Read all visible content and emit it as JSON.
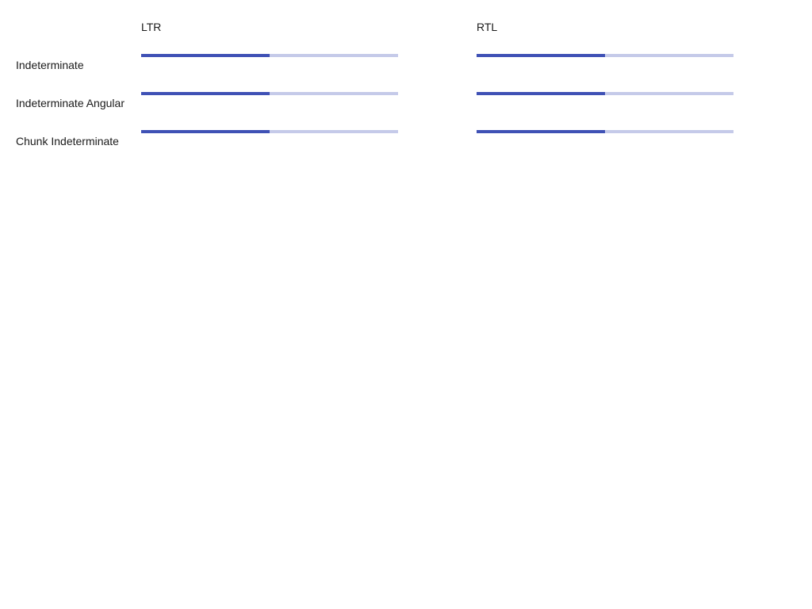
{
  "columns": {
    "ltr": "LTR",
    "rtl": "RTL"
  },
  "rows": [
    {
      "label": "Indeterminate"
    },
    {
      "label": "Indeterminate Angular"
    },
    {
      "label": "Chunk Indeterminate"
    }
  ],
  "colors": {
    "bar_fill": "#3f51b5",
    "bar_track": "#c5cae9"
  },
  "progress": {
    "fill_fraction": 0.5
  }
}
